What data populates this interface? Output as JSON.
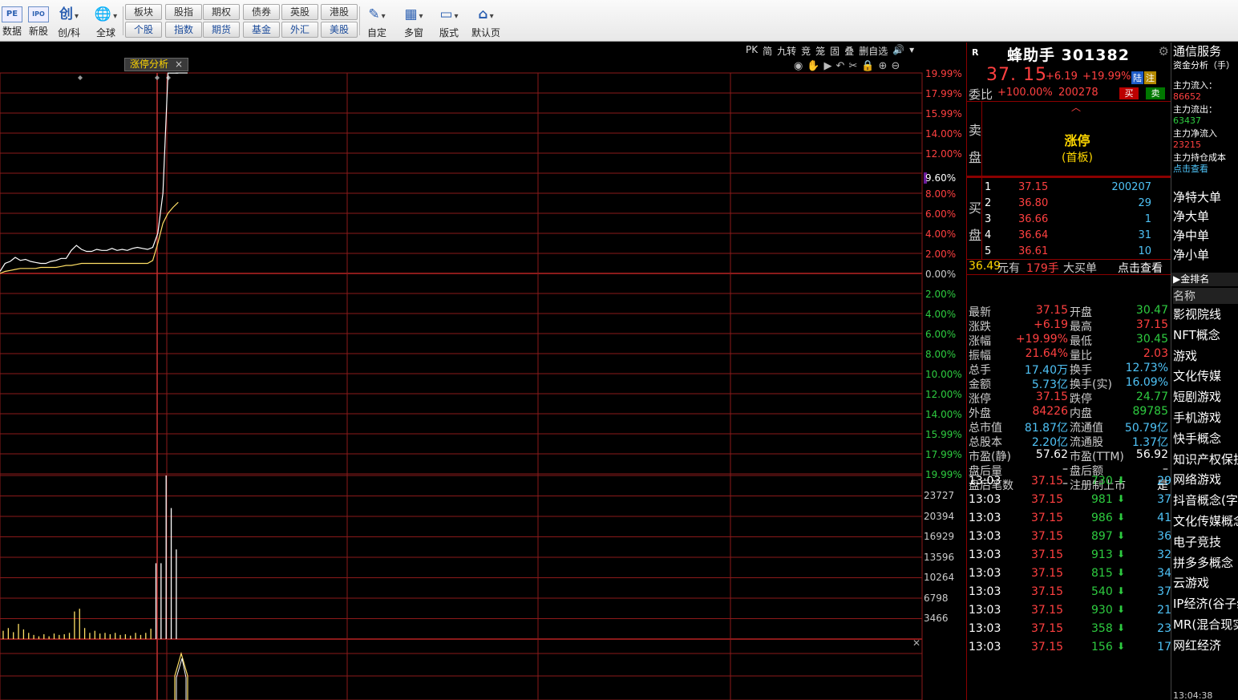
{
  "toolbar": {
    "icons": [
      {
        "label": "数据",
        "icon": "PE"
      },
      {
        "label": "新股",
        "icon": "IPO"
      },
      {
        "label": "创/科",
        "icon": "创"
      },
      {
        "label": "全球",
        "icon": "🌐"
      }
    ],
    "market_buttons_top": [
      "板块",
      "股指",
      "期权",
      "债券",
      "英股",
      "港股"
    ],
    "market_buttons_bottom": [
      "个股",
      "指数",
      "期货",
      "基金",
      "外汇",
      "美股"
    ],
    "right_icons": [
      {
        "label": "自定",
        "icon": "✎"
      },
      {
        "label": "多窗",
        "icon": "▦"
      },
      {
        "label": "版式",
        "icon": "▭"
      },
      {
        "label": "默认页",
        "icon": "⌂"
      }
    ]
  },
  "chart_toolbar": [
    "PK",
    "简",
    "九转",
    "竞",
    "笼",
    "固",
    "叠",
    "删自选",
    "🔊",
    "▾"
  ],
  "chart_tab": {
    "label": "涨停分析",
    "close": "×"
  },
  "chart_data": {
    "type": "line",
    "y_right_labels_top": [
      "19.99%",
      "17.99%",
      "15.99%",
      "14.00%",
      "12.00%",
      "9.60%",
      "8.00%",
      "6.00%",
      "4.00%",
      "2.00%",
      "0.00%",
      "2.00%",
      "4.00%",
      "6.00%",
      "8.00%",
      "10.00%",
      "12.00%",
      "14.00%",
      "15.99%",
      "17.99%",
      "19.99%"
    ],
    "volume_labels": [
      "23727",
      "20394",
      "16929",
      "13596",
      "10264",
      "6798",
      "3466"
    ],
    "price_pct_series": [
      0.2,
      1.0,
      1.2,
      1.6,
      1.3,
      1.4,
      1.2,
      1.1,
      1.0,
      1.0,
      1.2,
      1.3,
      1.5,
      1.5,
      2.3,
      2.8,
      2.4,
      2.2,
      2.2,
      2.4,
      2.3,
      2.3,
      2.5,
      2.3,
      2.4,
      2.3,
      2.5,
      2.6,
      2.5,
      2.4,
      2.6,
      4.0,
      8.0,
      19.99,
      19.99,
      19.99
    ],
    "avg_pct_series": [
      0.0,
      0.2,
      0.3,
      0.4,
      0.5,
      0.5,
      0.5,
      0.5,
      0.6,
      0.6,
      0.6,
      0.6,
      0.7,
      0.8,
      0.8,
      0.9,
      1.0,
      1.0,
      1.0,
      1.0,
      1.0,
      1.0,
      1.0,
      1.0,
      1.0,
      1.0,
      1.0,
      1.0,
      1.0,
      1.0,
      1.3,
      3.0,
      5.0,
      6.0,
      6.6,
      7.1
    ],
    "volume_series": [
      1200,
      1600,
      1000,
      2200,
      1400,
      900,
      600,
      400,
      700,
      400,
      800,
      600,
      700,
      900,
      4000,
      4400,
      1600,
      900,
      1200,
      800,
      900,
      700,
      900,
      600,
      700,
      500,
      900,
      600,
      900,
      1500,
      11000,
      11000,
      23727,
      19000,
      13000,
      0
    ]
  },
  "quote": {
    "badge": "R",
    "name": "蜂助手 301382",
    "price": "37. 15",
    "change": "+6.19",
    "change_pct": "+19.99%",
    "tag1": "陆",
    "tag2": "注",
    "weibi_label": "委比",
    "weibi_pct": "+100.00%",
    "weibi_vol": "200278",
    "buy_btn": "买",
    "sell_btn": "卖",
    "sell_side": [
      "卖",
      "盘"
    ],
    "buy_side": [
      "买",
      "盘"
    ],
    "limit_up": "涨停",
    "limit_up_sub": "(首板)",
    "bids": [
      {
        "i": "1",
        "p": "37.15",
        "v": "200207"
      },
      {
        "i": "2",
        "p": "36.80",
        "v": "29"
      },
      {
        "i": "3",
        "p": "36.66",
        "v": "1"
      },
      {
        "i": "4",
        "p": "36.64",
        "v": "31"
      },
      {
        "i": "5",
        "p": "36.61",
        "v": "10"
      }
    ],
    "big_buy": {
      "amount": "36.49",
      "unit": "元有",
      "hands": "179手",
      "label": "大买单",
      "link": "点击查看"
    }
  },
  "stats": [
    {
      "k": "最新",
      "v": "37.15",
      "c": "#ff4040"
    },
    {
      "k": "开盘",
      "v": "30.47",
      "c": "#2ecc40"
    },
    {
      "k": "涨跌",
      "v": "+6.19",
      "c": "#ff4040"
    },
    {
      "k": "最高",
      "v": "37.15",
      "c": "#ff4040"
    },
    {
      "k": "涨幅",
      "v": "+19.99%",
      "c": "#ff4040"
    },
    {
      "k": "最低",
      "v": "30.45",
      "c": "#2ecc40"
    },
    {
      "k": "振幅",
      "v": "21.64%",
      "c": "#ff4040"
    },
    {
      "k": "量比",
      "v": "2.03",
      "c": "#ff4040"
    },
    {
      "k": "总手",
      "v": "17.40万",
      "c": "#4fc3f7"
    },
    {
      "k": "换手",
      "v": "12.73%",
      "c": "#4fc3f7"
    },
    {
      "k": "金额",
      "v": "5.73亿",
      "c": "#4fc3f7"
    },
    {
      "k": "换手(实)",
      "v": "16.09%",
      "c": "#4fc3f7"
    },
    {
      "k": "涨停",
      "v": "37.15",
      "c": "#ff4040"
    },
    {
      "k": "跌停",
      "v": "24.77",
      "c": "#2ecc40"
    },
    {
      "k": "外盘",
      "v": "84226",
      "c": "#ff4040"
    },
    {
      "k": "内盘",
      "v": "89785",
      "c": "#2ecc40"
    },
    {
      "k": "总市值",
      "v": "81.87亿",
      "c": "#4fc3f7"
    },
    {
      "k": "流通值",
      "v": "50.79亿",
      "c": "#4fc3f7"
    },
    {
      "k": "总股本",
      "v": "2.20亿",
      "c": "#4fc3f7"
    },
    {
      "k": "流通股",
      "v": "1.37亿",
      "c": "#4fc3f7"
    },
    {
      "k": "市盈(静)",
      "v": "57.62",
      "c": "#ffffff"
    },
    {
      "k": "市盈(TTM)",
      "v": "56.92",
      "c": "#ffffff"
    },
    {
      "k": "盘后量",
      "v": "–",
      "c": "#ffffff"
    },
    {
      "k": "盘后额",
      "v": "–",
      "c": "#ffffff"
    },
    {
      "k": "盘后笔数",
      "v": "–",
      "c": "#ffffff"
    },
    {
      "k": "注册制上市",
      "v": "是",
      "c": "#ffffff"
    }
  ],
  "trades": [
    {
      "t": "13:03",
      "p": "37.15",
      "v": "730",
      "n": "29"
    },
    {
      "t": "13:03",
      "p": "37.15",
      "v": "981",
      "n": "37"
    },
    {
      "t": "13:03",
      "p": "37.15",
      "v": "986",
      "n": "41"
    },
    {
      "t": "13:03",
      "p": "37.15",
      "v": "897",
      "n": "36"
    },
    {
      "t": "13:03",
      "p": "37.15",
      "v": "913",
      "n": "32"
    },
    {
      "t": "13:03",
      "p": "37.15",
      "v": "815",
      "n": "34"
    },
    {
      "t": "13:03",
      "p": "37.15",
      "v": "540",
      "n": "37"
    },
    {
      "t": "13:03",
      "p": "37.15",
      "v": "930",
      "n": "21"
    },
    {
      "t": "13:03",
      "p": "37.15",
      "v": "358",
      "n": "23"
    },
    {
      "t": "13:03",
      "p": "37.15",
      "v": "156",
      "n": "17"
    }
  ],
  "far_right": {
    "industry": "通信服务",
    "fund_title": "资金分析（手）",
    "main_in_label": "主力流入：",
    "main_in": "86652",
    "main_out_label": "主力流出：",
    "main_out": "63437",
    "main_net_label": "主力净流入",
    "main_net": "23215",
    "main_cost_label": "主力持仓成本",
    "main_cost_link": "点击查看",
    "net_labels": [
      "净特大单",
      "净大单",
      "净中单",
      "净小单"
    ],
    "rank_bar": "▶金排名",
    "name_header": "名称",
    "concepts": [
      "影视院线",
      "NFT概念",
      "游戏",
      "文化传媒",
      "短剧游戏",
      "手机游戏",
      "快手概念",
      "知识产权保护",
      "网络游戏",
      "抖音概念(字节概念)",
      "文化传媒概念",
      "电子竞技",
      "拼多多概念",
      "云游戏",
      "IP经济(谷子经济)",
      "MR(混合现实)",
      "网红经济"
    ],
    "footer_time": "13:04:38"
  }
}
